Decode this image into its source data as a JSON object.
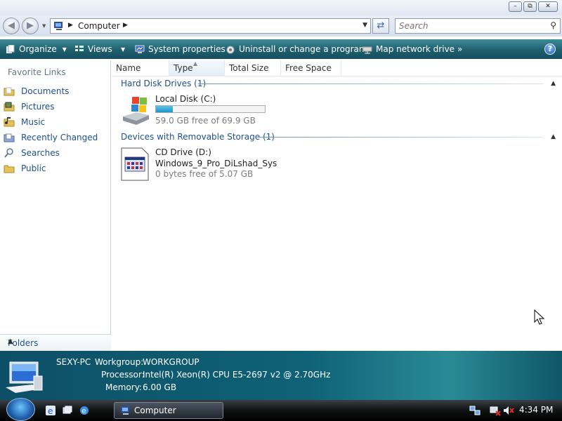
{
  "address": {
    "location": "Computer",
    "search_placeholder": "Search"
  },
  "toolbar": {
    "organize": "Organize",
    "views": "Views",
    "system_properties": "System properties",
    "uninstall": "Uninstall or change a program",
    "map_drive": "Map network drive",
    "more": "»",
    "help": "?"
  },
  "sidebar": {
    "title": "Favorite Links",
    "items": [
      {
        "label": "Documents",
        "icon": "folder-icon"
      },
      {
        "label": "Pictures",
        "icon": "pictures-folder-icon"
      },
      {
        "label": "Music",
        "icon": "music-folder-icon"
      },
      {
        "label": "Recently Changed",
        "icon": "recent-folder-icon"
      },
      {
        "label": "Searches",
        "icon": "search-icon"
      },
      {
        "label": "Public",
        "icon": "folder-icon"
      }
    ],
    "folders": "Folders"
  },
  "columns": [
    "Name",
    "Type",
    "Total Size",
    "Free Space"
  ],
  "groups": {
    "hdd": {
      "title": "Hard Disk Drives (1)",
      "drives": [
        {
          "name": "Local Disk (C:)",
          "free": "59.0 GB free of 69.9 GB",
          "used_fraction": 0.156
        }
      ]
    },
    "removable": {
      "title": "Devices with Removable Storage (1)",
      "drives": [
        {
          "name": "CD Drive (D:)",
          "label": "Windows_9_Pro_DiLshad_Sys",
          "free": "0 bytes free of 5.07 GB"
        }
      ]
    }
  },
  "details": {
    "computer_name": "SEXY-PC",
    "workgroup_label": "Workgroup:",
    "workgroup": "WORKGROUP",
    "processor_label": "Processor:",
    "processor": "Intel(R) Xeon(R) CPU E5-2697 v2 @ 2.70GHz",
    "memory_label": "Memory:",
    "memory": "6.00 GB"
  },
  "taskbar": {
    "window_button": "Computer",
    "clock": "4:34 PM"
  }
}
